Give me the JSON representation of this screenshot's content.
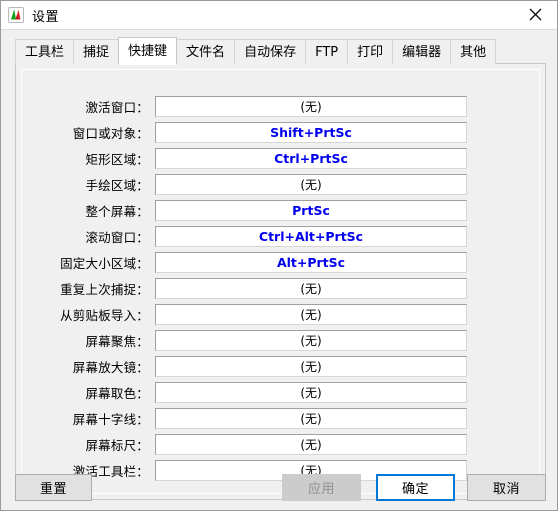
{
  "window": {
    "title": "设置",
    "app_icon": "faststone-capture-icon",
    "close_label": "×"
  },
  "tabs": [
    {
      "label": "工具栏",
      "name": "tab-toolbar",
      "selected": false
    },
    {
      "label": "捕捉",
      "name": "tab-capture",
      "selected": false
    },
    {
      "label": "快捷键",
      "name": "tab-hotkeys",
      "selected": true
    },
    {
      "label": "文件名",
      "name": "tab-filename",
      "selected": false
    },
    {
      "label": "自动保存",
      "name": "tab-autosave",
      "selected": false
    },
    {
      "label": "FTP",
      "name": "tab-ftp",
      "selected": false
    },
    {
      "label": "打印",
      "name": "tab-print",
      "selected": false
    },
    {
      "label": "编辑器",
      "name": "tab-editor",
      "selected": false
    },
    {
      "label": "其他",
      "name": "tab-other",
      "selected": false
    }
  ],
  "hotkeys": {
    "none_value": "(无)",
    "rows": [
      {
        "label": "激活窗口：",
        "value": "(无)",
        "assigned": false
      },
      {
        "label": "窗口或对象：",
        "value": "Shift+PrtSc",
        "assigned": true
      },
      {
        "label": "矩形区域：",
        "value": "Ctrl+PrtSc",
        "assigned": true
      },
      {
        "label": "手绘区域：",
        "value": "(无)",
        "assigned": false
      },
      {
        "label": "整个屏幕：",
        "value": "PrtSc",
        "assigned": true
      },
      {
        "label": "滚动窗口：",
        "value": "Ctrl+Alt+PrtSc",
        "assigned": true
      },
      {
        "label": "固定大小区域：",
        "value": "Alt+PrtSc",
        "assigned": true
      },
      {
        "label": "重复上次捕捉：",
        "value": "(无)",
        "assigned": false
      },
      {
        "label": "从剪贴板导入：",
        "value": "(无)",
        "assigned": false
      },
      {
        "label": "屏幕聚焦：",
        "value": "(无)",
        "assigned": false
      },
      {
        "label": "屏幕放大镜：",
        "value": "(无)",
        "assigned": false
      },
      {
        "label": "屏幕取色：",
        "value": "(无)",
        "assigned": false
      },
      {
        "label": "屏幕十字线：",
        "value": "(无)",
        "assigned": false
      },
      {
        "label": "屏幕标尺：",
        "value": "(无)",
        "assigned": false
      },
      {
        "label": "激活工具栏：",
        "value": "(无)",
        "assigned": false
      }
    ]
  },
  "footer": {
    "reset_label": "重置",
    "apply_label": "应用",
    "ok_label": "确定",
    "cancel_label": "取消",
    "apply_enabled": false,
    "ok_focused": true
  },
  "colors": {
    "hotkey_text": "#0000ee",
    "focus_border": "#0078d7",
    "window_bg": "#f0f0f0",
    "field_bg": "#ffffff",
    "disabled_text": "#8f8f8f"
  }
}
